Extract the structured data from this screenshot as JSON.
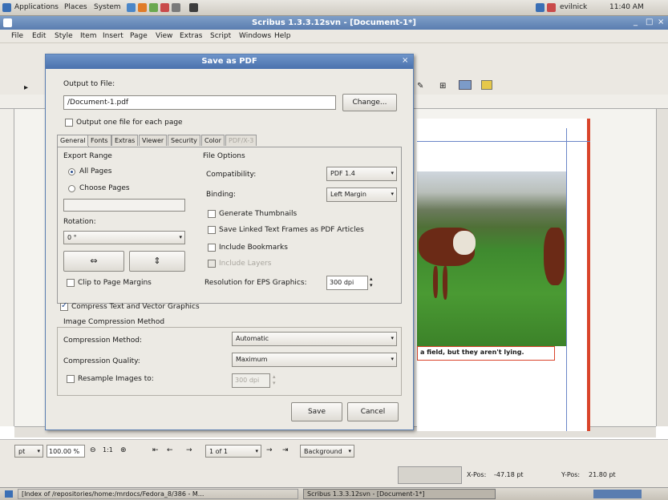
{
  "top_panel": {
    "menus": [
      "Applications",
      "Places",
      "System"
    ],
    "user": "evilnick",
    "clock": "11:40 AM"
  },
  "window": {
    "title": "Scribus 1.3.3.12svn - [Document-1*]",
    "menu": [
      "File",
      "Edit",
      "Style",
      "Item",
      "Insert",
      "Page",
      "View",
      "Extras",
      "Script",
      "Windows",
      "Help"
    ]
  },
  "document": {
    "caption": "a field, but they aren't lying."
  },
  "dialog": {
    "title": "Save as PDF",
    "output_label": "Output to File:",
    "output_value": "/Document-1.pdf",
    "change_button": "Change...",
    "one_file_per_page": "Output one file for each page",
    "tabs": [
      "General",
      "Fonts",
      "Extras",
      "Viewer",
      "Security",
      "Color",
      "PDF/X-3"
    ],
    "export_range_label": "Export Range",
    "all_pages": "All Pages",
    "choose_pages": "Choose Pages",
    "rotation_label": "Rotation:",
    "rotation_value": "0 °",
    "clip_margins": "Clip to Page Margins",
    "file_options_label": "File Options",
    "compatibility_label": "Compatibility:",
    "compatibility_value": "PDF 1.4",
    "binding_label": "Binding:",
    "binding_value": "Left Margin",
    "gen_thumbnails": "Generate Thumbnails",
    "save_linked": "Save Linked Text Frames as PDF Articles",
    "include_bookmarks": "Include Bookmarks",
    "include_layers": "Include Layers",
    "resolution_label": "Resolution for EPS Graphics:",
    "resolution_value": "300 dpi",
    "compress_text": "Compress Text and Vector Graphics",
    "image_compression_label": "Image Compression Method",
    "compression_method_label": "Compression Method:",
    "compression_method_value": "Automatic",
    "compression_quality_label": "Compression Quality:",
    "compression_quality_value": "Maximum",
    "resample_label": "Resample Images to:",
    "resample_value": "300 dpi",
    "save_button": "Save",
    "cancel_button": "Cancel"
  },
  "statusbar": {
    "zoom": "100.00 %",
    "ratio": "1:1",
    "page": "1 of 1",
    "layer": "Background",
    "xpos_label": "X-Pos:",
    "xpos_value": "-47.18 pt",
    "ypos_label": "Y-Pos:",
    "ypos_value": "21.80 pt"
  },
  "taskbar": {
    "item1": "[Index of /repositories/home:/mrdocs/Fedora_8/386 - M...",
    "item2": "Scribus 1.3.3.12svn - [Document-1*]"
  },
  "colors": {
    "title_blue": "#5a7db0",
    "page_border": "#d9442a"
  }
}
